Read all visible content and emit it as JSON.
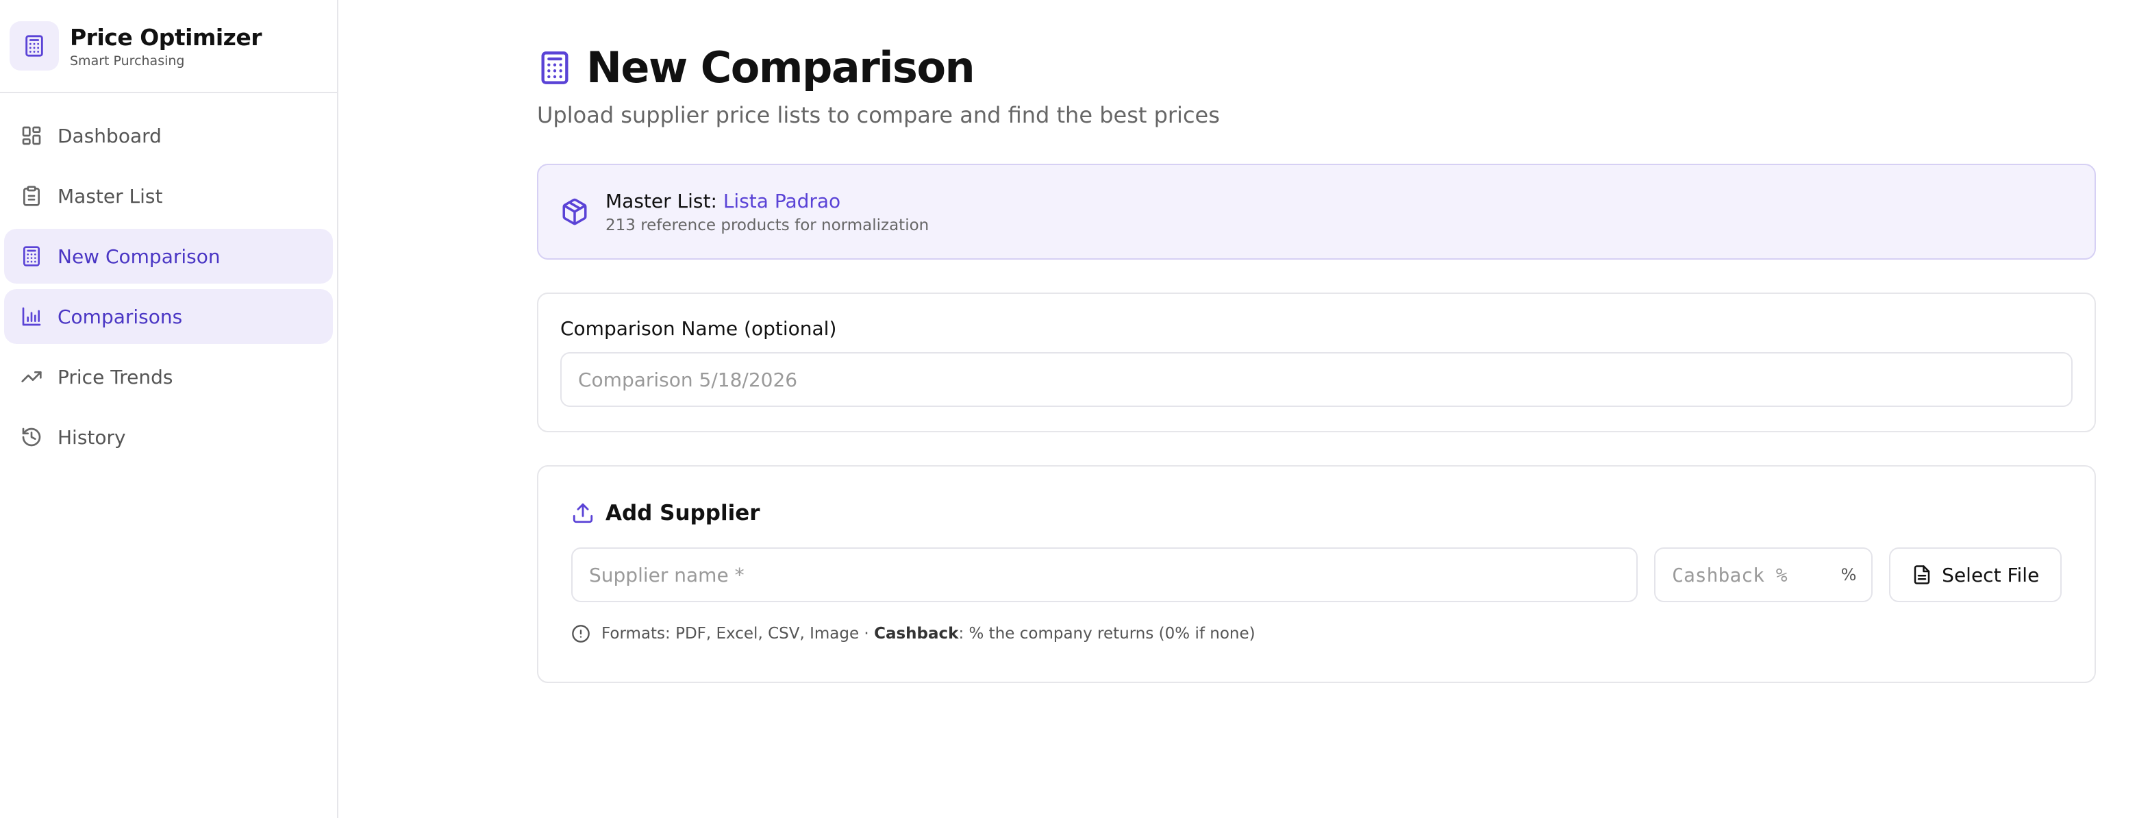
{
  "brand": {
    "title": "Price Optimizer",
    "subtitle": "Smart Purchasing",
    "icon": "calculator-icon"
  },
  "sidebar": {
    "items": [
      {
        "label": "Dashboard",
        "icon": "dashboard-icon",
        "active": false
      },
      {
        "label": "Master List",
        "icon": "clipboard-icon",
        "active": false
      },
      {
        "label": "New Comparison",
        "icon": "calculator-icon",
        "active": true
      },
      {
        "label": "Comparisons",
        "icon": "bar-chart-icon",
        "active": true
      },
      {
        "label": "Price Trends",
        "icon": "trending-up-icon",
        "active": false
      },
      {
        "label": "History",
        "icon": "history-icon",
        "active": false
      }
    ]
  },
  "header": {
    "title": "New Comparison",
    "subtitle": "Upload supplier price lists to compare and find the best prices"
  },
  "master_list": {
    "label": "Master List:",
    "name": "Lista Padrao",
    "count_text": "213 reference products for normalization"
  },
  "comparison_name": {
    "label": "Comparison Name (optional)",
    "placeholder": "Comparison 5/18/2026",
    "value": ""
  },
  "supplier": {
    "title": "Add Supplier",
    "name_placeholder": "Supplier name *",
    "cashback_placeholder": "Cashback %",
    "percent_symbol": "%",
    "select_file_label": "Select File",
    "hint_prefix": "Formats: PDF, Excel, CSV, Image · ",
    "hint_bold": "Cashback",
    "hint_suffix": ": % the company returns (0% if none)"
  },
  "colors": {
    "accent": "#5a43d6",
    "accent_bg": "#efecfb",
    "border": "#e6e6ea"
  }
}
